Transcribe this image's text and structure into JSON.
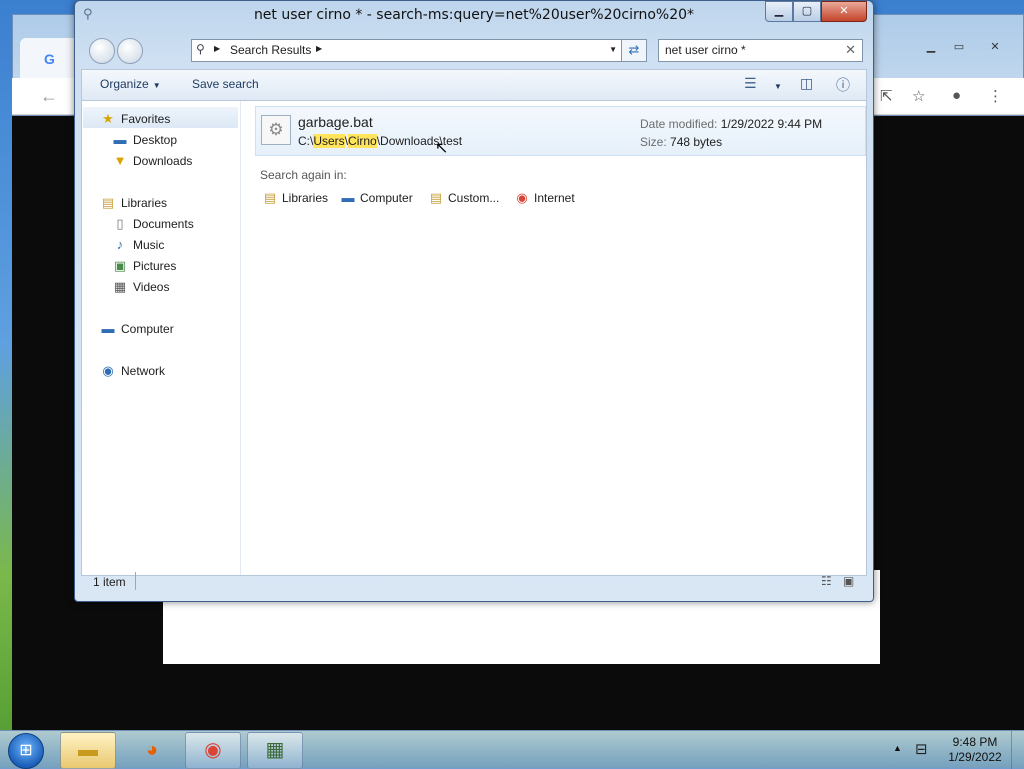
{
  "explorer": {
    "title": "net user cirno * - search-ms:query=net%20user%20cirno%20*",
    "address_crumb": "Search Results",
    "search_value": "net user cirno *",
    "commands": {
      "organize": "Organize",
      "save_search": "Save search"
    },
    "nav": {
      "favorites": "Favorites",
      "desktop": "Desktop",
      "downloads": "Downloads",
      "libraries": "Libraries",
      "documents": "Documents",
      "music": "Music",
      "pictures": "Pictures",
      "videos": "Videos",
      "computer": "Computer",
      "network": "Network"
    },
    "result": {
      "name": "garbage.bat",
      "path_prefix": "C:\\",
      "path_users": "Users",
      "path_sep1": "\\",
      "path_cirno": "Cirno",
      "path_rest": "\\Downloads\\test",
      "date_label": "Date modified:",
      "date_value": "1/29/2022 9:44 PM",
      "size_label": "Size:",
      "size_value": "748 bytes"
    },
    "search_again": {
      "label": "Search again in:",
      "libraries": "Libraries",
      "computer": "Computer",
      "custom": "Custom...",
      "internet": "Internet"
    },
    "status": {
      "item_count": "1 item"
    }
  },
  "taskbar": {
    "time": "9:48 PM",
    "date": "1/29/2022"
  },
  "icons": {
    "search": "search-icon",
    "back": "back-arrow-icon",
    "forward": "forward-arrow-icon",
    "up": "up-arrow-icon",
    "refresh": "refresh-icon",
    "views": "views-icon",
    "preview_pane": "preview-pane-icon",
    "help": "help-icon",
    "batch_file": "batch-file-icon"
  },
  "colors": {
    "highlight": "#ffe45c",
    "close_button": "#c4442b",
    "title_bar": "#bed5ec"
  }
}
